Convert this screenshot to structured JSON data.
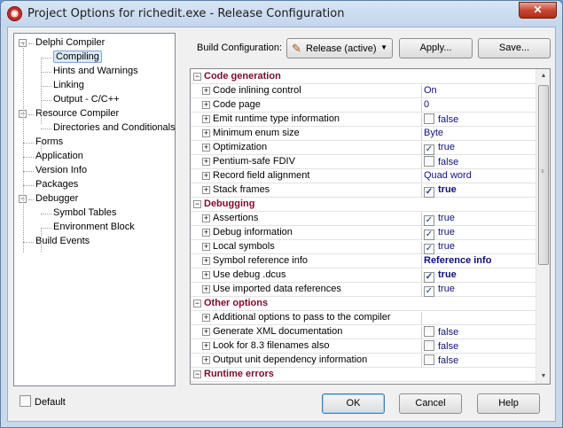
{
  "window": {
    "title": "Project Options for richedit.exe - Release Configuration",
    "close_glyph": "✕",
    "icon_name": "delphi-app-icon"
  },
  "tree": {
    "items": [
      {
        "label": "Delphi Compiler",
        "toggle": "−"
      },
      {
        "label": "Compiling",
        "selected": true
      },
      {
        "label": "Hints and Warnings"
      },
      {
        "label": "Linking"
      },
      {
        "label": "Output - C/C++"
      },
      {
        "label": "Resource Compiler",
        "toggle": "−"
      },
      {
        "label": "Directories and Conditionals"
      },
      {
        "label": "Forms"
      },
      {
        "label": "Application"
      },
      {
        "label": "Version Info"
      },
      {
        "label": "Packages"
      },
      {
        "label": "Debugger",
        "toggle": "−"
      },
      {
        "label": "Symbol Tables"
      },
      {
        "label": "Environment Block"
      },
      {
        "label": "Build Events"
      }
    ]
  },
  "build_config": {
    "label": "Build Configuration:",
    "selected": "Release (active)",
    "apply_label": "Apply...",
    "save_label": "Save..."
  },
  "grid": {
    "sections": [
      {
        "title": "Code generation",
        "rows": [
          {
            "name": "Code inlining control",
            "value": "On"
          },
          {
            "name": "Code page",
            "value": "0"
          },
          {
            "name": "Emit runtime type information",
            "value": "false",
            "checkbox": false
          },
          {
            "name": "Minimum enum size",
            "value": "Byte"
          },
          {
            "name": "Optimization",
            "value": "true",
            "checkbox": true
          },
          {
            "name": "Pentium-safe FDIV",
            "value": "false",
            "checkbox": false
          },
          {
            "name": "Record field alignment",
            "value": "Quad word"
          },
          {
            "name": "Stack frames",
            "value": "true",
            "checkbox": true,
            "bold": true
          }
        ]
      },
      {
        "title": "Debugging",
        "rows": [
          {
            "name": "Assertions",
            "value": "true",
            "checkbox": true
          },
          {
            "name": "Debug information",
            "value": "true",
            "checkbox": true
          },
          {
            "name": "Local symbols",
            "value": "true",
            "checkbox": true
          },
          {
            "name": "Symbol reference info",
            "value": "Reference info",
            "bold": true
          },
          {
            "name": "Use debug .dcus",
            "value": "true",
            "checkbox": true,
            "bold": true
          },
          {
            "name": "Use imported data references",
            "value": "true",
            "checkbox": true
          }
        ]
      },
      {
        "title": "Other options",
        "rows": [
          {
            "name": "Additional options to pass to the compiler",
            "value": ""
          },
          {
            "name": "Generate XML documentation",
            "value": "false",
            "checkbox": false
          },
          {
            "name": "Look for 8.3 filenames also",
            "value": "false",
            "checkbox": false
          },
          {
            "name": "Output unit dependency information",
            "value": "false",
            "checkbox": false
          }
        ]
      },
      {
        "title": "Runtime errors",
        "rows": []
      }
    ]
  },
  "footer": {
    "default_label": "Default",
    "ok_label": "OK",
    "cancel_label": "Cancel",
    "help_label": "Help"
  },
  "colors": {
    "category_text": "#7a0c2a",
    "value_text": "#10107e",
    "selection": "#dbe9f8"
  }
}
